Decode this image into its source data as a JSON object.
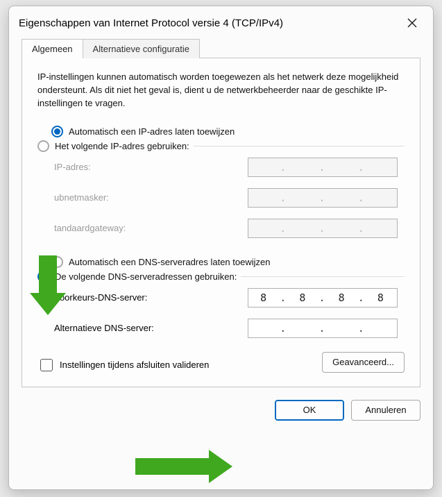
{
  "dialog": {
    "title": "Eigenschappen van Internet Protocol versie 4 (TCP/IPv4)"
  },
  "tabs": {
    "active": "Algemeen",
    "inactive": "Alternatieve configuratie"
  },
  "description": "IP-instellingen kunnen automatisch worden toegewezen als het netwerk deze mogelijkheid ondersteunt. Als dit niet het geval is, dient u de netwerkbeheerder naar de geschikte IP-instellingen te vragen.",
  "ip_section": {
    "option_auto": "Automatisch een IP-adres laten toewijzen",
    "option_manual": "Het volgende IP-adres gebruiken:",
    "selected": "auto",
    "fields": {
      "ip_address_label": "IP-adres:",
      "ip_address_value": "",
      "subnet_label": "ubnetmasker:",
      "subnet_value": "",
      "gateway_label": "tandaardgateway:",
      "gateway_value": ""
    }
  },
  "dns_section": {
    "option_auto": "Automatisch een DNS-serveradres laten toewijzen",
    "option_manual": "De volgende DNS-serveradressen gebruiken:",
    "selected": "manual",
    "fields": {
      "preferred_label": "Voorkeurs-DNS-server:",
      "preferred_value": [
        "8",
        "8",
        "8",
        "8"
      ],
      "alternate_label": "Alternatieve DNS-server:",
      "alternate_value": [
        "",
        "",
        "",
        ""
      ]
    }
  },
  "validate_label": "Instellingen tijdens afsluiten valideren",
  "validate_checked": false,
  "buttons": {
    "advanced": "Geavanceerd...",
    "ok": "OK",
    "cancel": "Annuleren"
  }
}
